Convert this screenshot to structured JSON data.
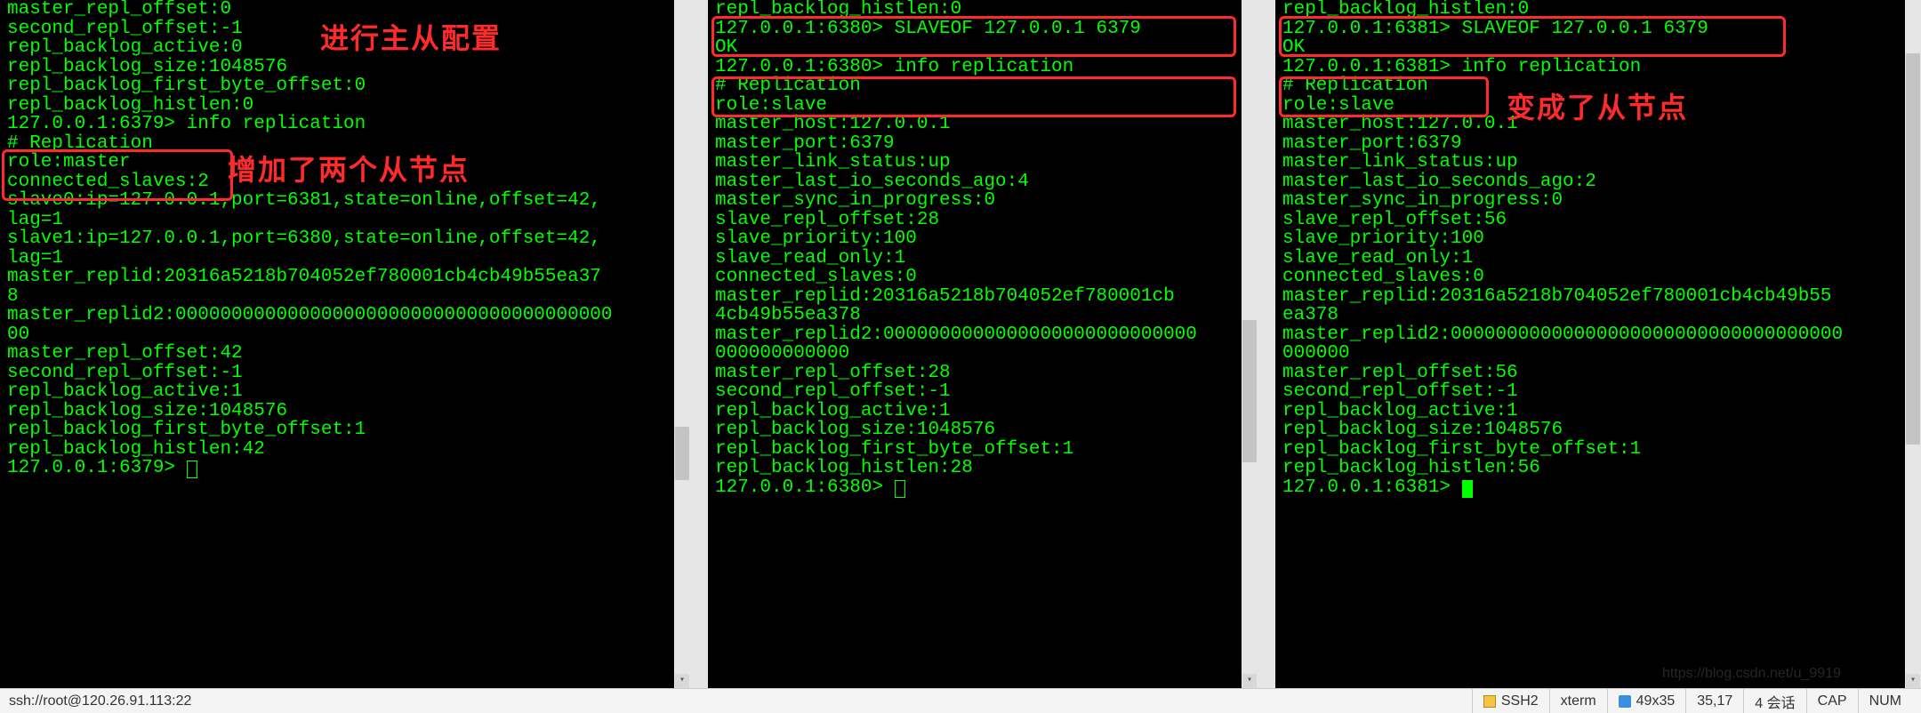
{
  "annotations": {
    "a1": "进行主从配置",
    "a2": "增加了两个从节点",
    "a3": "变成了从节点"
  },
  "statusbar": {
    "conn": "ssh://root@120.26.91.113:22",
    "proto": "SSH2",
    "term": "xterm",
    "size": "49x35",
    "pos": "35,17",
    "sessions": "4 会话",
    "caps": "CAP",
    "num": "NUM"
  },
  "watermark": "https://blog.csdn.net/u_9919",
  "panes": {
    "left": {
      "lines": [
        "master_repl_offset:0",
        "second_repl_offset:-1",
        "repl_backlog_active:0",
        "repl_backlog_size:1048576",
        "repl_backlog_first_byte_offset:0",
        "repl_backlog_histlen:0",
        "127.0.0.1:6379> info replication",
        "# Replication",
        "role:master",
        "connected_slaves:2",
        "slave0:ip=127.0.0.1,port=6381,state=online,offset=42,",
        "lag=1",
        "slave1:ip=127.0.0.1,port=6380,state=online,offset=42,",
        "lag=1",
        "master_replid:20316a5218b704052ef780001cb4cb49b55ea37",
        "8",
        "master_replid2:000000000000000000000000000000000000000",
        "00",
        "master_repl_offset:42",
        "second_repl_offset:-1",
        "repl_backlog_active:1",
        "repl_backlog_size:1048576",
        "repl_backlog_first_byte_offset:1",
        "repl_backlog_histlen:42"
      ],
      "prompt": "127.0.0.1:6379> "
    },
    "mid": {
      "lines": [
        "repl_backlog_histlen:0",
        "127.0.0.1:6380> SLAVEOF 127.0.0.1 6379",
        "OK",
        "127.0.0.1:6380> info replication",
        "# Replication",
        "role:slave",
        "master_host:127.0.0.1",
        "master_port:6379",
        "master_link_status:up",
        "master_last_io_seconds_ago:4",
        "master_sync_in_progress:0",
        "slave_repl_offset:28",
        "slave_priority:100",
        "slave_read_only:1",
        "connected_slaves:0",
        "master_replid:20316a5218b704052ef780001cb",
        "4cb49b55ea378",
        "master_replid2:0000000000000000000000000000",
        "000000000000",
        "master_repl_offset:28",
        "second_repl_offset:-1",
        "repl_backlog_active:1",
        "repl_backlog_size:1048576",
        "repl_backlog_first_byte_offset:1",
        "repl_backlog_histlen:28"
      ],
      "prompt": "127.0.0.1:6380> "
    },
    "right": {
      "lines": [
        "repl_backlog_histlen:0",
        "127.0.0.1:6381> SLAVEOF 127.0.0.1 6379",
        "OK",
        "127.0.0.1:6381> info replication",
        "# Replication",
        "role:slave",
        "master_host:127.0.0.1",
        "master_port:6379",
        "master_link_status:up",
        "master_last_io_seconds_ago:2",
        "master_sync_in_progress:0",
        "slave_repl_offset:56",
        "slave_priority:100",
        "slave_read_only:1",
        "connected_slaves:0",
        "master_replid:20316a5218b704052ef780001cb4cb49b55",
        "ea378",
        "master_replid2:00000000000000000000000000000000000",
        "000000",
        "master_repl_offset:56",
        "second_repl_offset:-1",
        "repl_backlog_active:1",
        "repl_backlog_size:1048576",
        "repl_backlog_first_byte_offset:1",
        "repl_backlog_histlen:56"
      ],
      "prompt": "127.0.0.1:6381> "
    }
  }
}
